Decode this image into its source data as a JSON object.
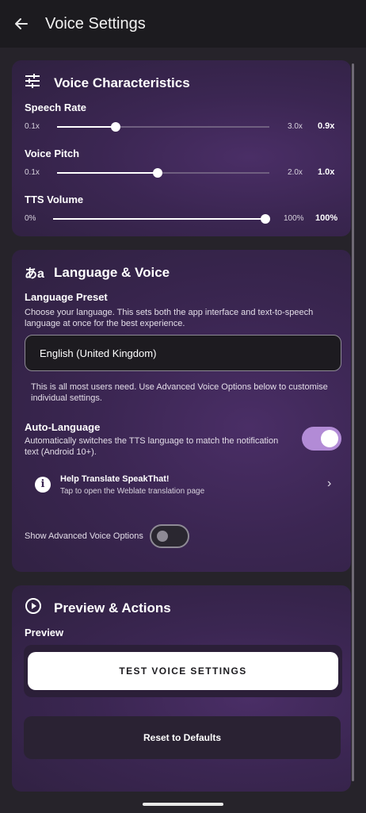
{
  "appbar": {
    "title": "Voice Settings",
    "back_icon": "arrow-left-icon"
  },
  "voice_characteristics": {
    "title": "Voice Characteristics",
    "icon": "tune-icon",
    "speech_rate": {
      "label": "Speech Rate",
      "min": "0.1x",
      "max": "3.0x",
      "value_text": "0.9x",
      "value": 0.9,
      "range": [
        0.1,
        3.0
      ]
    },
    "voice_pitch": {
      "label": "Voice Pitch",
      "min": "0.1x",
      "max": "2.0x",
      "value_text": "1.0x",
      "value": 1.0,
      "range": [
        0.1,
        2.0
      ]
    },
    "tts_volume": {
      "label": "TTS Volume",
      "min": "0%",
      "max": "100%",
      "value_text": "100%",
      "value": 100,
      "range": [
        0,
        100
      ]
    }
  },
  "language_voice": {
    "title": "Language & Voice",
    "icon": "translate-icon",
    "preset_label": "Language Preset",
    "preset_desc": "Choose your language. This sets both the app interface and text-to-speech language at once for the best experience.",
    "selected_language": "English (United Kingdom)",
    "helper_text": "This is all most users need. Use Advanced Voice Options below to customise individual settings.",
    "auto_language": {
      "label": "Auto-Language",
      "desc": "Automatically switches the TTS language to match the notification text (Android 10+).",
      "enabled": true
    },
    "help_translate": {
      "title": "Help Translate SpeakThat!",
      "subtitle": "Tap to open the Weblate translation page",
      "icon": "info-icon",
      "chevron": "›"
    },
    "advanced": {
      "label": "Show Advanced Voice Options",
      "enabled": false
    }
  },
  "preview_actions": {
    "title": "Preview & Actions",
    "icon": "play-circle-icon",
    "preview_label": "Preview",
    "test_button": "TEST VOICE SETTINGS",
    "reset_button": "Reset to Defaults"
  },
  "colors": {
    "accent": "#b28bd6",
    "card": "#3b2652",
    "background": "#1c1b1f"
  }
}
